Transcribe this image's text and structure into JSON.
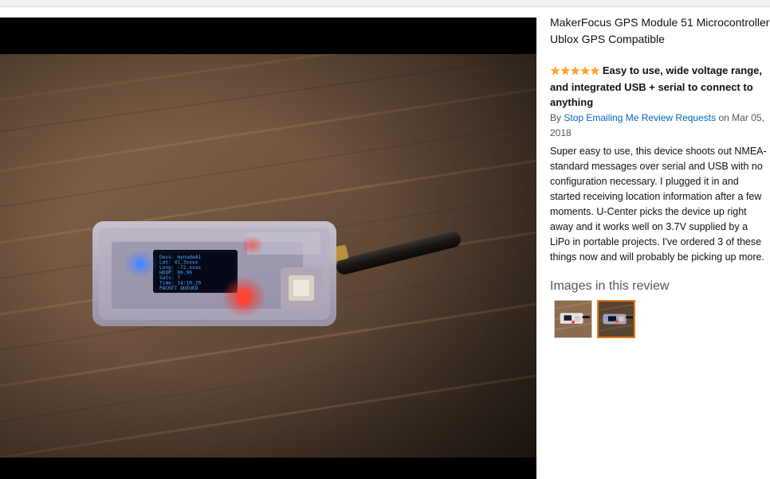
{
  "product": {
    "title": "MakerFocus GPS Module 51 Microcontroller Ublox GPS Compatible"
  },
  "review": {
    "rating_stars": "★★★★★",
    "rating_value": 5,
    "title": "Easy to use, wide voltage range, and integrated USB + serial to connect to anything",
    "by_label": "By",
    "author": "Stop Emailing Me Review Requests",
    "date_prefix": "on",
    "date": "Mar 05, 2018",
    "body": "Super easy to use, this device shoots out NMEA-standard messages over serial and USB with no configuration necessary. I plugged it in and started receiving location information after a few moments. U-Center picks the device up right away and it works well on 3.7V supplied by a LiPo in portable projects. I've ordered 3 of these things now and will probably be picking up more."
  },
  "images_section": {
    "heading": "Images in this review",
    "selected_index": 1
  },
  "screen_text": {
    "lines": [
      "Devs: mynodeA1",
      "Lat: 41.3xxxx",
      "Long: -72.xxxx",
      "HDOP: 00.99",
      "Sats: 7",
      "Time: 14:10:29",
      "PACKET QUEUED"
    ]
  },
  "colors": {
    "star": "#ffa41c",
    "link": "#0066c0",
    "selected_border": "#e47911",
    "oled_text": "#4fa8ff",
    "led_red": "#ff2a2a"
  }
}
